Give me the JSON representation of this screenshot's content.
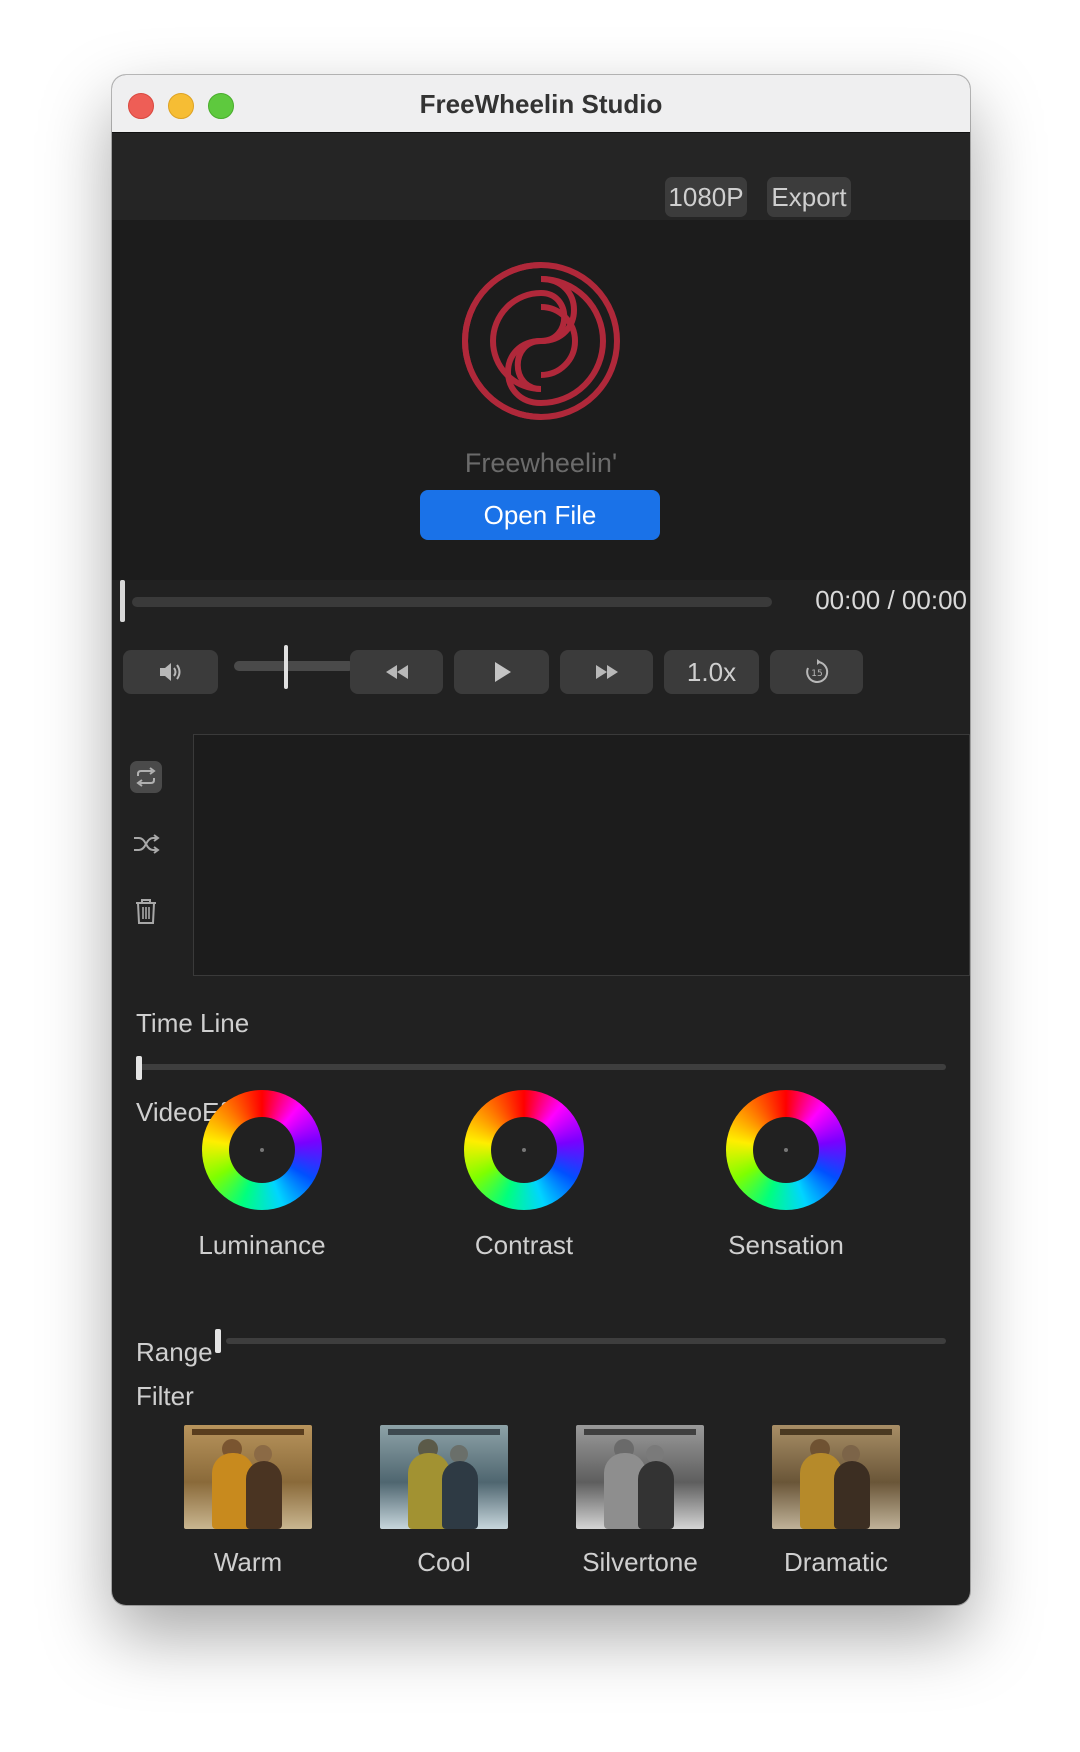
{
  "window": {
    "title": "FreeWheelin Studio"
  },
  "toolbar": {
    "resolution_label": "1080P",
    "export_label": "Export"
  },
  "preview": {
    "brand_name": "Freewheelin'",
    "open_file_label": "Open File"
  },
  "playback": {
    "time": "00:00 / 00:00",
    "progress": 0,
    "volume": 0.45,
    "speed_label": "1.0x",
    "replay_icon_number": "15"
  },
  "sidebar_icons": [
    "loop-icon",
    "shuffle-icon",
    "trash-icon"
  ],
  "timeline": {
    "label": "Time Line",
    "position": 0
  },
  "video_effect": {
    "label": "VideoEffect",
    "wheels": [
      {
        "label": "Luminance"
      },
      {
        "label": "Contrast"
      },
      {
        "label": "Sensation"
      }
    ]
  },
  "range": {
    "label": "Range",
    "value": 0
  },
  "filter": {
    "label": "Filter",
    "items": [
      {
        "label": "Warm"
      },
      {
        "label": "Cool"
      },
      {
        "label": "Silvertone"
      },
      {
        "label": "Dramatic"
      }
    ]
  },
  "colors": {
    "accent": "#1a72e8",
    "logo": "#b0283a",
    "background": "#212121"
  }
}
